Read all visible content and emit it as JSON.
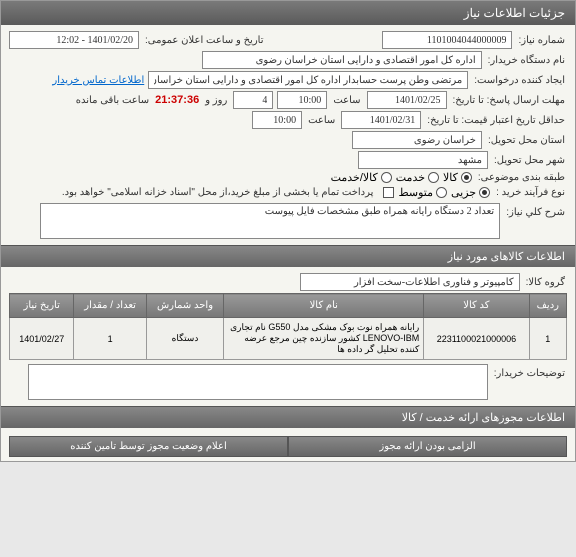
{
  "header": {
    "title": "جزئیات اطلاعات نیاز"
  },
  "need": {
    "number_label": "شماره نیاز:",
    "number": "1101004044000009",
    "announce_label": "تاریخ و ساعت اعلان عمومی:",
    "announce": "1401/02/20 - 12:02",
    "buyer_org_label": "نام دستگاه خریدار:",
    "buyer_org": "اداره کل امور اقتصادی و دارایی استان خراسان رضوی",
    "creator_label": "ایجاد کننده درخواست:",
    "creator": "مرتضی وطن پرست حسابدار اداره کل امور اقتصادی و دارایی استان خراسان رض",
    "contact_link": "اطلاعات تماس خریدار",
    "deadline_label": "مهلت ارسال پاسخ: تا تاریخ:",
    "deadline_date": "1401/02/25",
    "time_label": "ساعت",
    "deadline_time": "10:00",
    "days_label": "روز و",
    "days": "4",
    "remaining_label": "ساعت باقی مانده",
    "remaining_time": "21:37:36",
    "min_valid_label": "حداقل تاریخ اعتبار قیمت: تا تاریخ:",
    "min_valid_date": "1401/02/31",
    "min_valid_time": "10:00",
    "deliver_province_label": "استان محل تحویل:",
    "deliver_province": "خراسان رضوی",
    "deliver_city_label": "شهر محل تحویل:",
    "deliver_city": "مشهد",
    "category_label": "طبقه بندی موضوعی:",
    "cat_goods": "کالا",
    "cat_service": "خدمت",
    "cat_combo": "کالا/خدمت",
    "purchase_type_label": "نوع فرآیند خرید :",
    "purchase_jozi": "جزیی",
    "purchase_meto": "متوسط",
    "purchase_note": "پرداخت تمام یا بخشی از مبلغ خرید،از محل \"اسناد خزانه اسلامی\" خواهد بود.",
    "desc_label": "شرح کلي نیاز:",
    "desc": "تعداد 2 دستگاه رایانه همراه طبق مشخصات فایل پیوست"
  },
  "goods": {
    "section_title": "اطلاعات کالاهای مورد نیاز",
    "group_label": "گروه کالا:",
    "group": "کامپیوتر و فناوری اطلاعات-سخت افزار",
    "cols": {
      "row": "ردیف",
      "code": "کد کالا",
      "name": "نام کالا",
      "unit": "واحد شمارش",
      "qty": "تعداد / مقدار",
      "date": "تاریخ نیاز"
    },
    "rows": [
      {
        "index": "1",
        "code": "2231100021000006",
        "name": "رایانه همراه نوت بوک مشکی مدل G550 نام تجاری LENOVO-IBM کشور سازنده چین مرجع عرضه کننده تحلیل گر داده ها",
        "unit": "دستگاه",
        "qty": "1",
        "date": "1401/02/27"
      }
    ],
    "buyer_comments_label": "توضیحات خریدار:"
  },
  "licenses": {
    "section_title": "اطلاعات مجوزهای ارائه خدمت / کالا",
    "col1": "الزامی بودن ارائه مجوز",
    "col2": "اعلام وضعیت مجوز توسط تامین کننده"
  }
}
